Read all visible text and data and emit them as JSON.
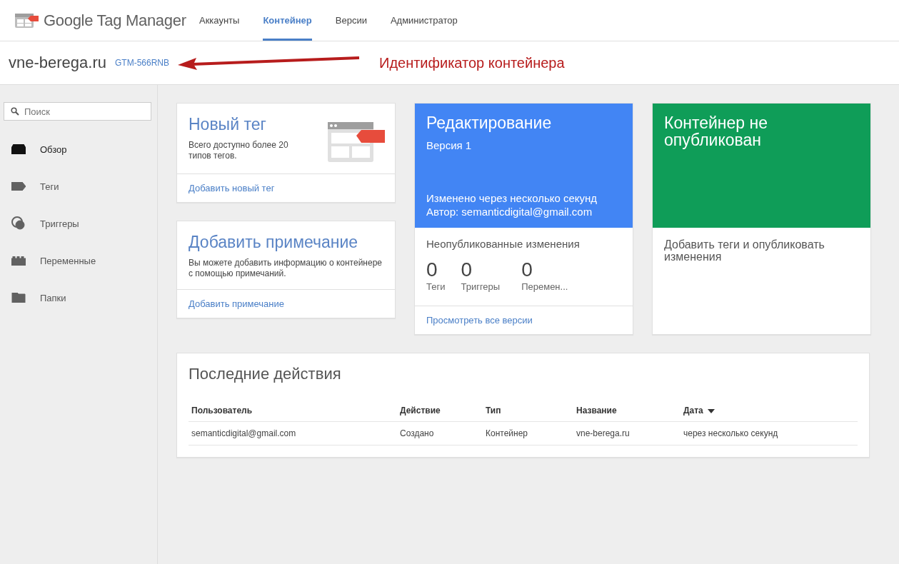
{
  "header": {
    "product": "Google Tag Manager",
    "tabs": [
      {
        "label": "Аккаунты",
        "selected": false
      },
      {
        "label": "Контейнер",
        "selected": true
      },
      {
        "label": "Версии",
        "selected": false
      },
      {
        "label": "Администратор",
        "selected": false
      }
    ]
  },
  "container_bar": {
    "name": "vne-berega.ru",
    "id": "GTM-566RNB",
    "annotation": "Идентификатор контейнера"
  },
  "sidebar": {
    "search": {
      "placeholder": "Поиск"
    },
    "items": [
      {
        "label": "Обзор",
        "kind": "overview",
        "selected": true
      },
      {
        "label": "Теги",
        "kind": "tags",
        "selected": false
      },
      {
        "label": "Триггеры",
        "kind": "triggers",
        "selected": false
      },
      {
        "label": "Переменные",
        "kind": "variables",
        "selected": false
      },
      {
        "label": "Папки",
        "kind": "folders",
        "selected": false
      }
    ]
  },
  "new_tag_card": {
    "title": "Новый тег",
    "text": "Всего доступно более 20 типов тегов.",
    "link": "Добавить новый тег"
  },
  "note_card": {
    "title": "Добавить примечание",
    "text": "Вы можете добавить информацию о контейнере с помощью примечаний.",
    "link": "Добавить примечание"
  },
  "workspace_card": {
    "title": "Редактирование",
    "version": "Версия 1",
    "modified": "Изменено через несколько секунд",
    "author": "Автор: semanticdigital@gmail.com",
    "changes_title": "Неопубликованные изменения",
    "stats": [
      {
        "value": "0",
        "label": "Теги"
      },
      {
        "value": "0",
        "label": "Триггеры"
      },
      {
        "value": "0",
        "label": "Перемен..."
      }
    ],
    "link": "Просмотреть все версии"
  },
  "publish_card": {
    "title": "Контейнер не опубликован",
    "text": "Добавить теги и опубликовать изменения"
  },
  "activity": {
    "title": "Последние действия",
    "columns": [
      {
        "label": "Пользователь",
        "sorted": false
      },
      {
        "label": "Действие",
        "sorted": false
      },
      {
        "label": "Тип",
        "sorted": false
      },
      {
        "label": "Название",
        "sorted": false
      },
      {
        "label": "Дата",
        "sorted": true
      }
    ],
    "rows": [
      [
        "semanticdigital@gmail.com",
        "Создано",
        "Контейнер",
        "vne-berega.ru",
        "через несколько секунд"
      ]
    ]
  }
}
